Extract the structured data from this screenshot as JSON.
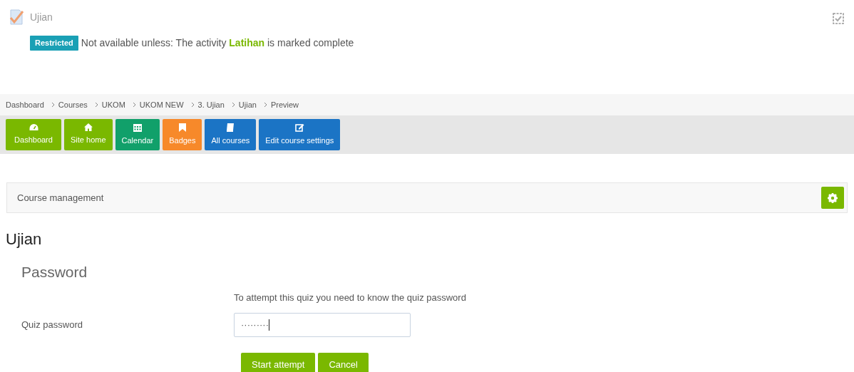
{
  "activity": {
    "title": "Ujian",
    "completion_checked": false,
    "badge": "Restricted",
    "restriction": "Not available unless: The activity **Latihan** is marked complete"
  },
  "breadcrumb": [
    "Dashboard",
    "Courses",
    "UKOM",
    "UKOM NEW",
    "3. Ujian",
    "Ujian",
    "Preview"
  ],
  "nav_buttons": [
    {
      "label": "Dashboard",
      "color": "#7ab800"
    },
    {
      "label": "Site home",
      "color": "#7ab800"
    },
    {
      "label": "Calendar",
      "color": "#11a06a"
    },
    {
      "label": "Badges",
      "color": "#f7892a"
    },
    {
      "label": "All courses",
      "color": "#1b74c5"
    },
    {
      "label": "Edit course settings",
      "color": "#1b74c5"
    }
  ],
  "course_management": {
    "label": "Course management"
  },
  "heading": "Ujian",
  "form": {
    "legend": "Password",
    "intro": "To attempt this quiz you need to know the quiz password",
    "field_label": "Quiz password",
    "value": "·········",
    "buttons": [
      "Start attempt",
      "Cancel"
    ]
  }
}
